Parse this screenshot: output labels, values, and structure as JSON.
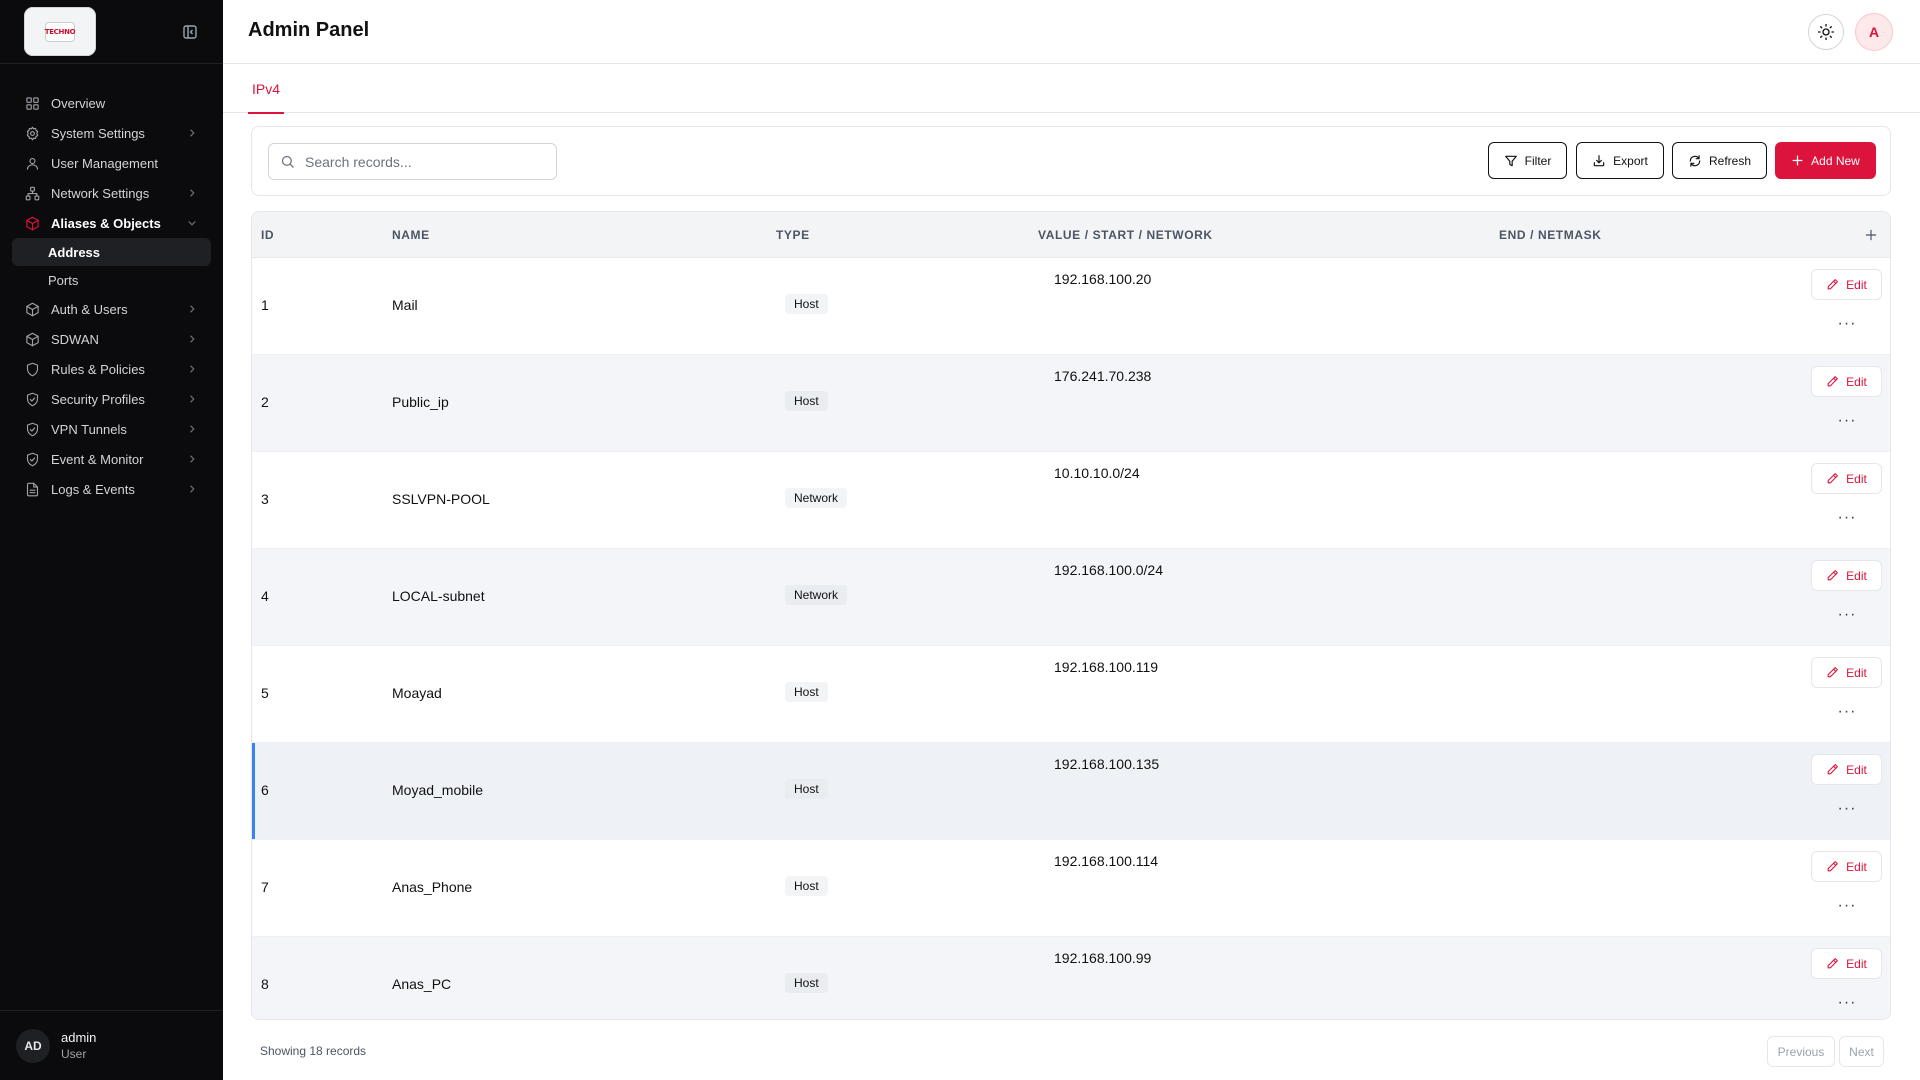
{
  "sidebar": {
    "logo_text": "TECHNO",
    "nav": [
      {
        "label": "Overview",
        "icon": "grid-icon",
        "chevron": false
      },
      {
        "label": "System Settings",
        "icon": "gear-icon",
        "chevron": true
      },
      {
        "label": "User Management",
        "icon": "user-icon",
        "chevron": false
      },
      {
        "label": "Network Settings",
        "icon": "network-icon",
        "chevron": true
      },
      {
        "label": "Aliases & Objects",
        "icon": "cube-icon",
        "chevron": true,
        "expanded": true
      },
      {
        "label": "Auth & Users",
        "icon": "cube-icon",
        "chevron": true
      },
      {
        "label": "SDWAN",
        "icon": "cube-icon",
        "chevron": true
      },
      {
        "label": "Rules & Policies",
        "icon": "shield-icon",
        "chevron": true
      },
      {
        "label": "Security Profiles",
        "icon": "shield-check-icon",
        "chevron": true
      },
      {
        "label": "VPN Tunnels",
        "icon": "shield-check-icon",
        "chevron": true
      },
      {
        "label": "Event & Monitor",
        "icon": "shield-check-icon",
        "chevron": true
      },
      {
        "label": "Logs & Events",
        "icon": "file-icon",
        "chevron": true
      }
    ],
    "sub_items": [
      "Address",
      "Ports"
    ],
    "user": {
      "initials": "AD",
      "name": "admin",
      "role": "User"
    }
  },
  "header": {
    "title": "Admin Panel",
    "avatar_letter": "A"
  },
  "tabs": [
    {
      "label": "IPv4",
      "active": true
    }
  ],
  "toolbar": {
    "search_placeholder": "Search records...",
    "filter_label": "Filter",
    "export_label": "Export",
    "refresh_label": "Refresh",
    "add_label": "Add New"
  },
  "table": {
    "columns": [
      "ID",
      "NAME",
      "TYPE",
      "VALUE / START / NETWORK",
      "END / NETMASK"
    ],
    "edit_label": "Edit",
    "rows": [
      {
        "id": "1",
        "name": "Mail",
        "type": "Host",
        "value": "192.168.100.20",
        "end": ""
      },
      {
        "id": "2",
        "name": "Public_ip",
        "type": "Host",
        "value": "176.241.70.238",
        "end": ""
      },
      {
        "id": "3",
        "name": "SSLVPN-POOL",
        "type": "Network",
        "value": "10.10.10.0/24",
        "end": ""
      },
      {
        "id": "4",
        "name": "LOCAL-subnet",
        "type": "Network",
        "value": "192.168.100.0/24",
        "end": ""
      },
      {
        "id": "5",
        "name": "Moayad",
        "type": "Host",
        "value": "192.168.100.119",
        "end": ""
      },
      {
        "id": "6",
        "name": "Moyad_mobile",
        "type": "Host",
        "value": "192.168.100.135",
        "end": ""
      },
      {
        "id": "7",
        "name": "Anas_Phone",
        "type": "Host",
        "value": "192.168.100.114",
        "end": ""
      },
      {
        "id": "8",
        "name": "Anas_PC",
        "type": "Host",
        "value": "192.168.100.99",
        "end": ""
      }
    ]
  },
  "footer": {
    "summary": "Showing 18 records",
    "prev_label": "Previous",
    "next_label": "Next"
  },
  "colors": {
    "accent": "#dc143c",
    "sidebar_bg": "#0b0b0d",
    "selected_row_marker": "#3b82f6"
  }
}
